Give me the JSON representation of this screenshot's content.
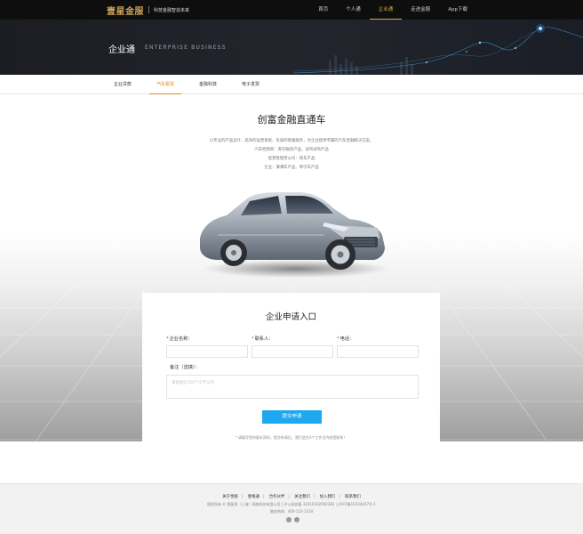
{
  "header": {
    "brand": "壹星金服",
    "slogan": "科技金融智造未来",
    "nav": [
      "首页",
      "个人通",
      "企业通",
      "走进金服",
      "App下载"
    ],
    "nav_active": "企业通"
  },
  "banner": {
    "title": "企业通",
    "subtitle": "ENTERPRISE BUSINESS"
  },
  "subnav": {
    "items": [
      "企业贷款",
      "汽车租赁",
      "金融科技",
      "电子发票"
    ],
    "active": "汽车租赁"
  },
  "hero": {
    "title": "创富金融直通车",
    "lines": [
      "以专业的产品设计、高效的运营系统、优质的客服服务，为企业提供专属的汽车金融解决方案。",
      "汽车经销商：库存融资产品、试驾试驾产品",
      "经营性租赁公司：购车产品",
      "企业：薄薄车产品、牵引车产品"
    ]
  },
  "form": {
    "title": "企业申请入口",
    "company_label": "企业名称：",
    "contact_label": "联系人：",
    "phone_label": "电话：",
    "remark_label": "备注（选填）：",
    "remark_placeholder": "请留留在250个汉字以内",
    "submit_label": "提交申请",
    "note": "* 请填写您的基本资料，提交申请后，我们会在3个工作日内给您联系！"
  },
  "footer": {
    "links": [
      "关于金服",
      "壹根通",
      "合作伙伴",
      "关注我们",
      "加入我们",
      "联系我们"
    ],
    "copyright": "版权所有 © 壹星贵（上海）网络科技有限公司  |  沪公网安备 31010102002383  |  沪ICP备15034427号-1",
    "phone": "服务热线：400-123-1234"
  },
  "colors": {
    "accent_gold": "#d4a84b",
    "accent_orange": "#e08a2e",
    "submit_blue": "#1ea8ef"
  }
}
